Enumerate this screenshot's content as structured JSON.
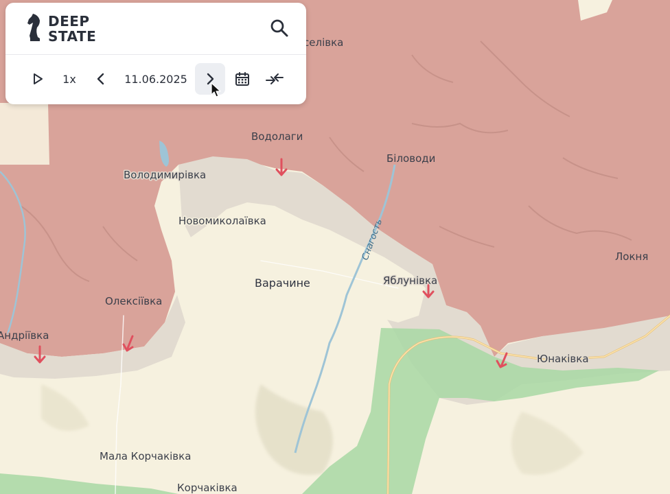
{
  "app": {
    "brand_line1": "DEEP",
    "brand_line2": "STATE",
    "logo_icon": "knight-chess-icon",
    "search_icon": "search-icon"
  },
  "timeline": {
    "play_icon": "play-icon",
    "speed": "1x",
    "prev_icon": "chevron-left-icon",
    "date": "11.06.2025",
    "next_icon": "chevron-right-icon",
    "calendar_icon": "calendar-icon",
    "compare_icon": "compare-arrows-icon"
  },
  "legend_colors": {
    "occupied": "#d9a39a",
    "contested": "#e2dbd0",
    "liberated": "#a8d8a4",
    "base": "#f6f1df",
    "attack_arrow": "#e0505e"
  },
  "places": {
    "seliivka": "селівка",
    "vodolahy": "Водолаги",
    "bilovody": "Біловоди",
    "volodymyrivka": "Володимирівка",
    "novomykolaivka": "Новомиколаївка",
    "snahost": "Снагость",
    "lokmia": "Локня",
    "varachyne": "Варачине",
    "yablunivka": "Яблунівка",
    "oleksiivka": "Олексіївка",
    "andriivka": "Андріївка",
    "yunakivka": "Юнаківка",
    "mala_korchakivka": "Мала Корчаківка",
    "korchakivka": "Корчаківка"
  }
}
